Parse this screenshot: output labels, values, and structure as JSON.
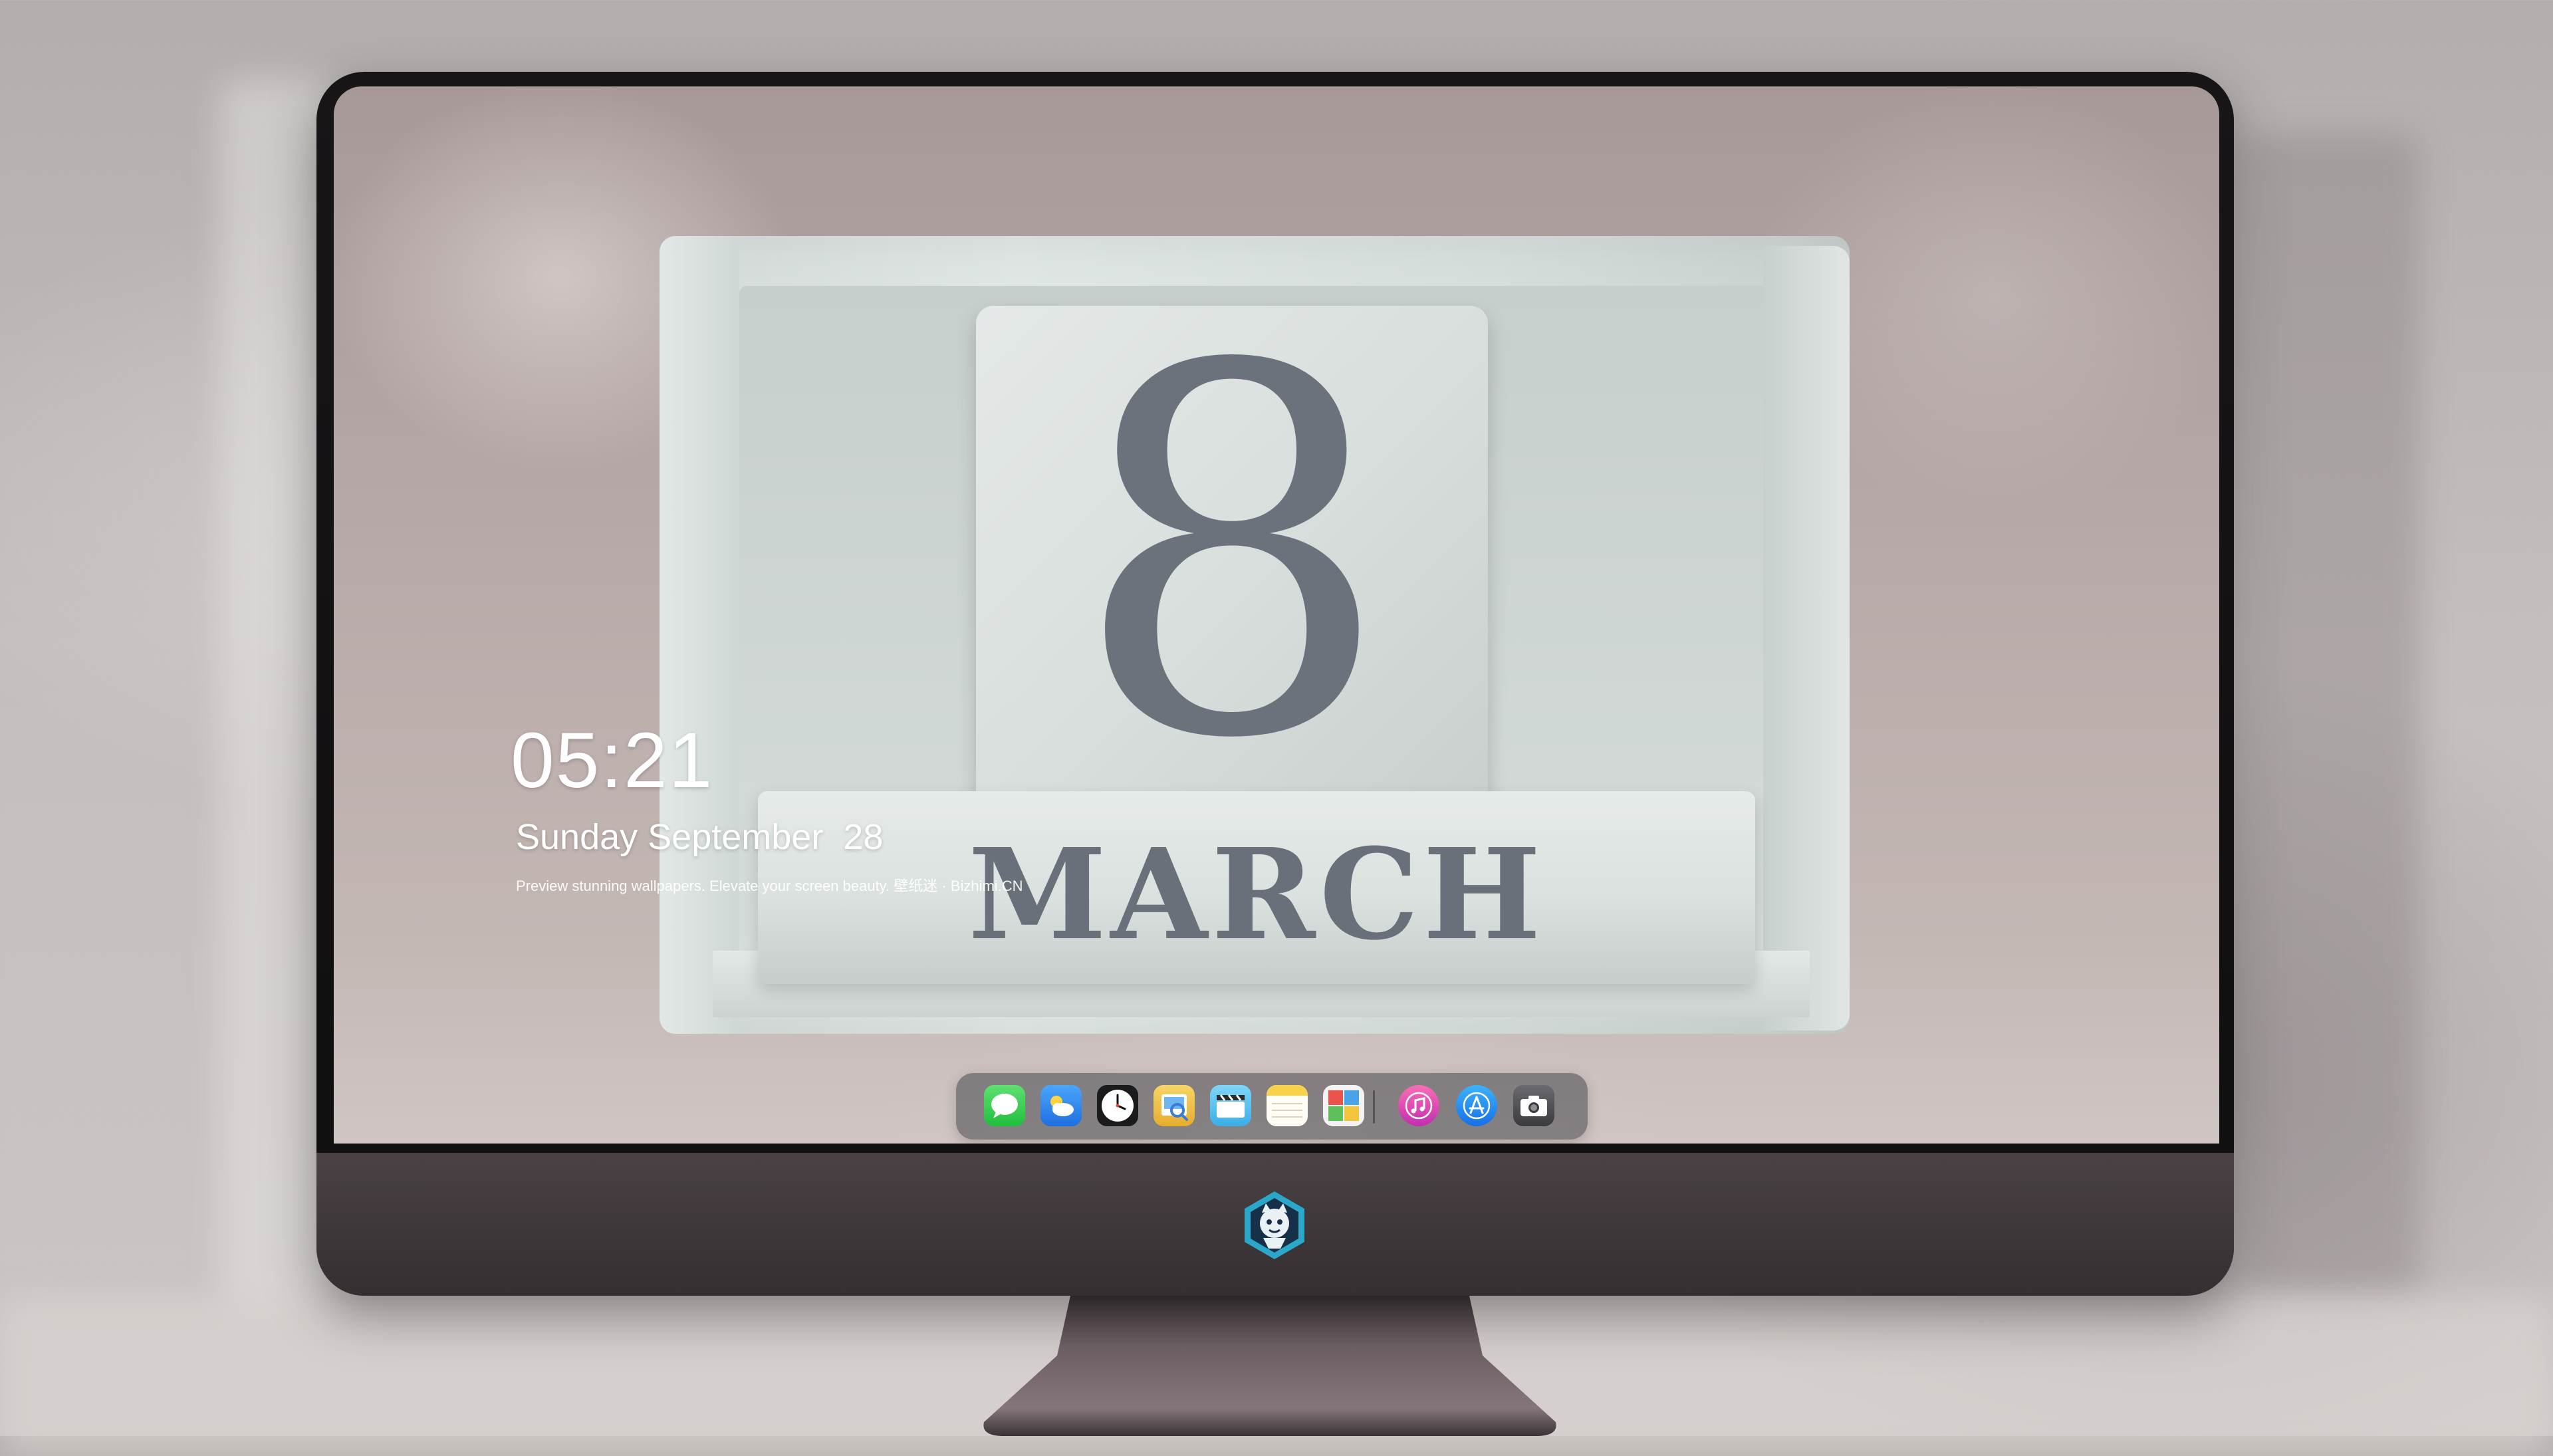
{
  "lock_screen": {
    "time": "05:21",
    "date": "Sunday September  28",
    "tagline": "Preview stunning wallpapers. Elevate your screen beauty. 壁纸迷 · Bizhimi.CN"
  },
  "wallpaper": {
    "day_number": "8",
    "month": "MARCH"
  },
  "dock": {
    "apps": [
      {
        "name": "messages",
        "icon": "message-bubble-icon",
        "color": "#3ad65a"
      },
      {
        "name": "weather",
        "icon": "cloud-sun-icon",
        "color": "#2f8ef5"
      },
      {
        "name": "clock",
        "icon": "clock-icon",
        "color": "#1c1c1c"
      },
      {
        "name": "preview",
        "icon": "preview-icon",
        "color": "#f0c23a"
      },
      {
        "name": "clips",
        "icon": "clapperboard-icon",
        "color": "#5bc4f0"
      },
      {
        "name": "notes",
        "icon": "notes-icon",
        "color": "#f7d34a"
      },
      {
        "name": "photo-booth",
        "icon": "photo-booth-icon",
        "color": "#3b7a4a"
      },
      {
        "name": "music",
        "icon": "music-note-icon",
        "color": "#e2458e"
      },
      {
        "name": "app-store",
        "icon": "app-store-icon",
        "color": "#1a8ff2"
      },
      {
        "name": "camera",
        "icon": "camera-icon",
        "color": "#4a4a4e"
      }
    ]
  },
  "colors": {
    "bezel": "#141213",
    "chin": "#433b3d",
    "block_text": "#6c727c"
  }
}
